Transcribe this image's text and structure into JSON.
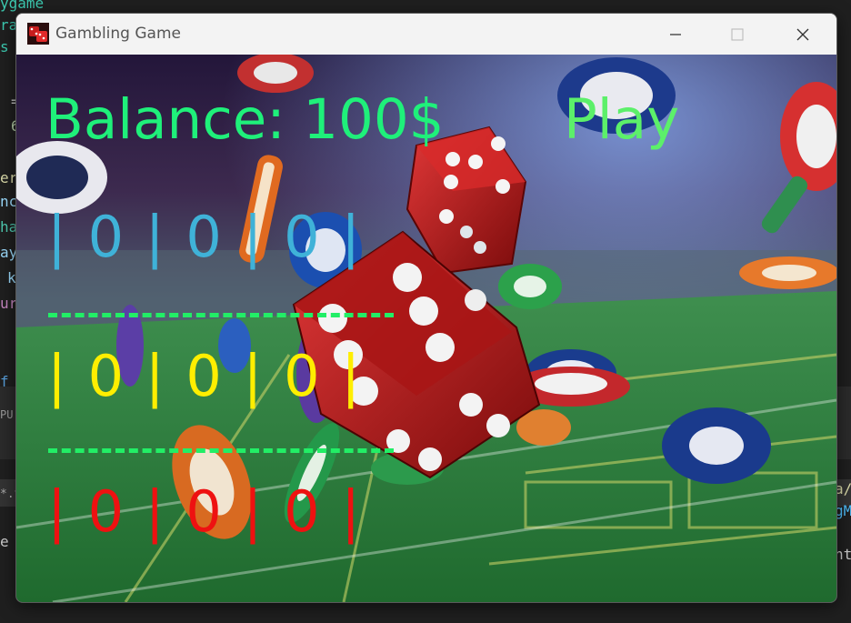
{
  "window": {
    "title": "Gambling Game",
    "minimize_icon": "minimize-icon",
    "maximize_icon": "maximize-icon",
    "close_icon": "close-icon"
  },
  "game": {
    "balance_text": "Balance: 100$",
    "play_text": "Play",
    "reels": [
      {
        "text": "| 0 | 0 | 0 |",
        "color": "#3fb2d8"
      },
      {
        "text": "| 0 | 0 | 0 |",
        "color": "#ffee00"
      },
      {
        "text": "| 0 | 0 | 0 |",
        "color": "#ee1111"
      }
    ],
    "separator_color": "#22ee66"
  },
  "background_editor": {
    "left_fragments": [
      "ygame",
      "ra",
      "s",
      "=",
      "6",
      "er",
      "nc",
      "ha",
      "ay",
      "k",
      "ur",
      "f",
      "PU",
      "*.t",
      "e b"
    ],
    "right_fragments": [
      "a/",
      "gM",
      "ht"
    ]
  }
}
